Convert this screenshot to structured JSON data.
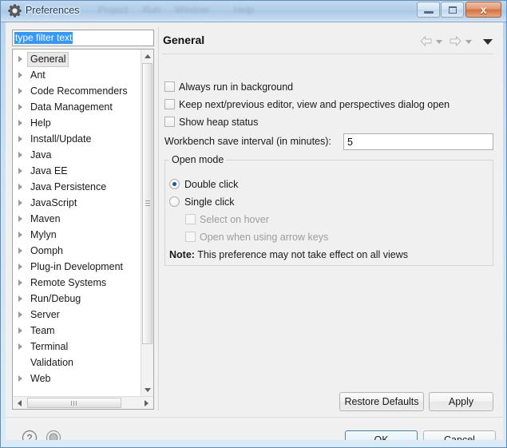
{
  "window": {
    "title": "Preferences",
    "icon": "preferences-gear-icon",
    "ghost_menu_text": [
      "Project",
      "Run",
      "Window",
      "Help"
    ],
    "controls": {
      "minimize": "Minimize",
      "maximize": "Maximize",
      "close": "x"
    }
  },
  "sidebar": {
    "filter": {
      "value": "type filter text",
      "placeholder": "type filter text",
      "selected": true
    },
    "items": [
      {
        "label": "General",
        "expandable": true,
        "selected": true
      },
      {
        "label": "Ant",
        "expandable": true,
        "selected": false
      },
      {
        "label": "Code Recommenders",
        "expandable": true,
        "selected": false
      },
      {
        "label": "Data Management",
        "expandable": true,
        "selected": false
      },
      {
        "label": "Help",
        "expandable": true,
        "selected": false
      },
      {
        "label": "Install/Update",
        "expandable": true,
        "selected": false
      },
      {
        "label": "Java",
        "expandable": true,
        "selected": false
      },
      {
        "label": "Java EE",
        "expandable": true,
        "selected": false
      },
      {
        "label": "Java Persistence",
        "expandable": true,
        "selected": false
      },
      {
        "label": "JavaScript",
        "expandable": true,
        "selected": false
      },
      {
        "label": "Maven",
        "expandable": true,
        "selected": false
      },
      {
        "label": "Mylyn",
        "expandable": true,
        "selected": false
      },
      {
        "label": "Oomph",
        "expandable": true,
        "selected": false
      },
      {
        "label": "Plug-in Development",
        "expandable": true,
        "selected": false
      },
      {
        "label": "Remote Systems",
        "expandable": true,
        "selected": false
      },
      {
        "label": "Run/Debug",
        "expandable": true,
        "selected": false
      },
      {
        "label": "Server",
        "expandable": true,
        "selected": false
      },
      {
        "label": "Team",
        "expandable": true,
        "selected": false
      },
      {
        "label": "Terminal",
        "expandable": true,
        "selected": false
      },
      {
        "label": "Validation",
        "expandable": false,
        "selected": false
      },
      {
        "label": "Web",
        "expandable": true,
        "selected": false
      }
    ]
  },
  "page": {
    "title": "General",
    "nav": {
      "back": "back-arrow",
      "back_menu": "back-dropdown",
      "forward": "forward-arrow",
      "forward_menu": "forward-dropdown",
      "menu": "view-menu"
    },
    "checkboxes": [
      {
        "label": "Always run in background",
        "checked": false,
        "enabled": true
      },
      {
        "label": "Keep next/previous editor, view and perspectives dialog open",
        "checked": false,
        "enabled": true
      },
      {
        "label": "Show heap status",
        "checked": false,
        "enabled": true
      }
    ],
    "save_interval": {
      "label": "Workbench save interval (in minutes):",
      "value": "5"
    },
    "open_mode": {
      "legend": "Open mode",
      "radios": [
        {
          "label": "Double click",
          "checked": true
        },
        {
          "label": "Single click",
          "checked": false
        }
      ],
      "sub_checkboxes": [
        {
          "label": "Select on hover",
          "checked": false,
          "enabled": false
        },
        {
          "label": "Open when using arrow keys",
          "checked": false,
          "enabled": false
        }
      ],
      "note_label": "Note:",
      "note_text": " This preference may not take effect on all views"
    },
    "buttons": {
      "restore_defaults": "Restore Defaults",
      "apply": "Apply"
    }
  },
  "footer": {
    "help_icon": "help-question-icon",
    "secondary_icon": "record-circle-icon",
    "ok": "OK",
    "cancel": "Cancel"
  },
  "colors": {
    "accent": "#3399ff",
    "focus_border": "#3c7fb1",
    "radio_dot": "#1a5b8f",
    "titlebar": "#b0cde8"
  }
}
